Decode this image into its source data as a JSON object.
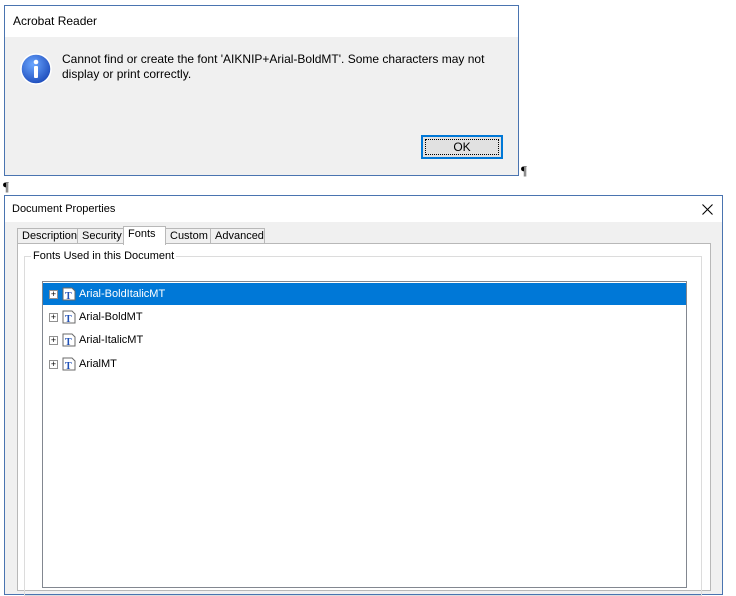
{
  "alert": {
    "title": "Acrobat Reader",
    "icon": "info-icon",
    "message": "Cannot find or create the font 'AIKNIP+Arial-BoldMT'. Some characters may not display or print correctly.",
    "ok_label": "OK"
  },
  "pilcrow": "¶",
  "doc_properties": {
    "title": "Document Properties",
    "close_icon": "close-icon",
    "tabs": [
      {
        "label": "Description"
      },
      {
        "label": "Security"
      },
      {
        "label": "Fonts",
        "active": true
      },
      {
        "label": "Custom"
      },
      {
        "label": "Advanced"
      }
    ],
    "group_label": "Fonts Used in this Document",
    "fonts": [
      {
        "name": "Arial-BoldItalicMT",
        "selected": true
      },
      {
        "name": "Arial-BoldMT"
      },
      {
        "name": "Arial-ItalicMT"
      },
      {
        "name": "ArialMT"
      }
    ],
    "colors": {
      "selection": "#0078d7",
      "accent_border": "#4a74b0"
    }
  }
}
